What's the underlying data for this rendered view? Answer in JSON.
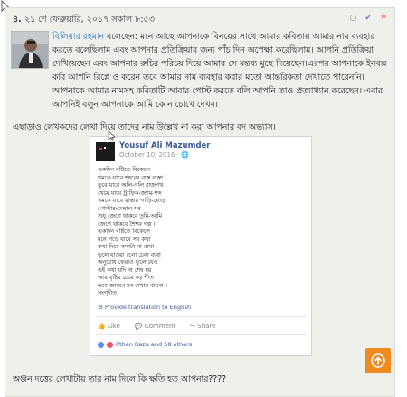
{
  "comment": {
    "number": "৪.",
    "datetime": "২১ শে ফেব্রুয়ারি, ২০১৭ সকাল ৮:৫৩",
    "author": "বিলিয়ার রহমান",
    "paragraph_first_line": "বলেছেন: মনে আছে আপনাকে বিনয়ের সাথে আমার কবিতায় আমার নাম ব্যবহার",
    "paragraph_rest": "করতে বলেছিলাম এবং আপনার প্রতিক্রিয়ার জন্য পাঁচ দিন অপেক্ষা করেছিলাম। আপনি প্রতিক্রিয়া দেখিয়েছেন এবং আপনার রুচির পরিচয় দিয়ে আমার সে মন্তব্য মুছে দিয়েছেন।এরপর আপনাকে ইনবক্স করি আপনি রিপ্লে ও করেন তবে আমার নাম ব্যবহার করার মতো আন্তরিকতা দেখাতে পারেননি। আপনাকে আমার নামসহ কবিতাটি আবার পোস্ট করতে বলি আপনি তাও প্রত্যাখ্যান করেছেন। এবার আপনিই বলুন আপনাকে আমি কোন চোখে দেখব।",
    "line2": "এছাড়াও লেখকদের লেখা দিয়ে তাদের নাম উল্লেখ না করা আপনার বদ অভ্যাস।",
    "bottom_line": "অঞ্জন দত্তের লেখাটায় তার নাম দিলে কি ক্ষতি হত আপনার????"
  },
  "fb_post": {
    "name": "Yousuf Ali Mazumder",
    "date": "October 10, 2016 · 🌐",
    "poem_lines": [
      "একদিন বৃষ্টিতে বিকেলে",
      "থমকে যাবে শহরের ব্যস্ত রাস্তা",
      "ডুবে যাবে অলি-গলি রাজপথ",
      "থেমে যাবে ট্রাফিক-জ্যাম-শব্দ",
      "থমকে যাবে রাস্তার গাড়ি-ঘোড়া",
      "পোস্টার-দেয়াল সব",
      "শুধু জেগে থাকবে তুমি-আমি",
      "জেগে থাকবে শৈশব গল্প ।",
      "একদিন বৃষ্টিতে বিকেলে",
      "মনে পড়ে যাবে সব কথা",
      "কথা দিয়ে কথাটা না রাখা",
      "ভুলে যাওয়া চেনা চেনা ব্যথা",
      "অনুরোধ ফেরাও ভুলে যেও",
      "এই কথা যদি না শেষ হয়",
      "আর বৃষ্টির চেয়ে বড় শীত",
      "তবে জানবে মন রাখার বায়না ।",
      "সংগৃহীত"
    ],
    "translate_label": "Provide translation to English",
    "like_label": "Like",
    "comment_label": "Comment",
    "share_label": "Share",
    "likers_text": "Ifthan Razu and 58 others"
  },
  "icons": {
    "comment_status": "circle-icon",
    "verified": "check-icon",
    "report": "flag-icon",
    "scroll_top": "arrow-up-icon"
  },
  "colors": {
    "background": "#eef0ec",
    "author_link": "#1f6fc0",
    "scroll_button": "#f18a1e",
    "fb_link": "#365899"
  }
}
